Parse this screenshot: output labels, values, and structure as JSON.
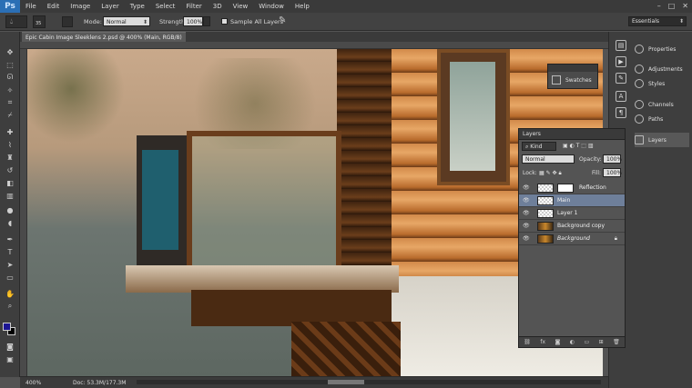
{
  "app": {
    "logo": "Ps",
    "menu": [
      "File",
      "Edit",
      "Image",
      "Layer",
      "Type",
      "Select",
      "Filter",
      "3D",
      "View",
      "Window",
      "Help"
    ],
    "window_controls": [
      "–",
      "□",
      "✕"
    ]
  },
  "options_bar": {
    "brush_size": "35",
    "mode_label": "Mode:",
    "mode_value": "Normal",
    "strength_label": "Strength:",
    "strength_value": "100%",
    "sample_all_layers": "Sample All Layers",
    "workspace": "Essentials"
  },
  "document": {
    "tab_title": "Epic Cabin Image Sleeklens 2.psd @ 400% (Main, RGB/8) *",
    "tab_close": "×",
    "zoom": "400%",
    "doc_size": "Doc: 53.3M/177.3M"
  },
  "colors": {
    "foreground": "#1c1593",
    "background": "#000000"
  },
  "dock_panels": [
    {
      "label": "Properties",
      "icon": "properties-icon"
    },
    {
      "label": "Adjustments",
      "icon": "adjustments-icon"
    },
    {
      "label": "Styles",
      "icon": "styles-icon"
    },
    {
      "label": "Channels",
      "icon": "channels-icon"
    },
    {
      "label": "Paths",
      "icon": "paths-icon"
    },
    {
      "label": "Layers",
      "icon": "layers-icon"
    }
  ],
  "swatches": {
    "label": "Swatches"
  },
  "layers_panel": {
    "title": "Layers",
    "filter": "Kind",
    "blend_mode": "Normal",
    "opacity_label": "Opacity:",
    "opacity_value": "100%",
    "lock_label": "Lock:",
    "fill_label": "Fill:",
    "fill_value": "100%",
    "layers": [
      {
        "name": "Reflection",
        "selected": false,
        "locked": false,
        "has_mask": true
      },
      {
        "name": "Main",
        "selected": true,
        "locked": false,
        "has_mask": false
      },
      {
        "name": "Layer 1",
        "selected": false,
        "locked": false,
        "has_mask": false
      },
      {
        "name": "Background copy",
        "selected": false,
        "locked": false,
        "has_mask": false
      },
      {
        "name": "Background",
        "selected": false,
        "locked": true,
        "has_mask": false
      }
    ],
    "footer_icons": [
      "link-icon",
      "fx-icon",
      "mask-icon",
      "adjustment-icon",
      "folder-icon",
      "new-layer-icon",
      "trash-icon"
    ]
  }
}
